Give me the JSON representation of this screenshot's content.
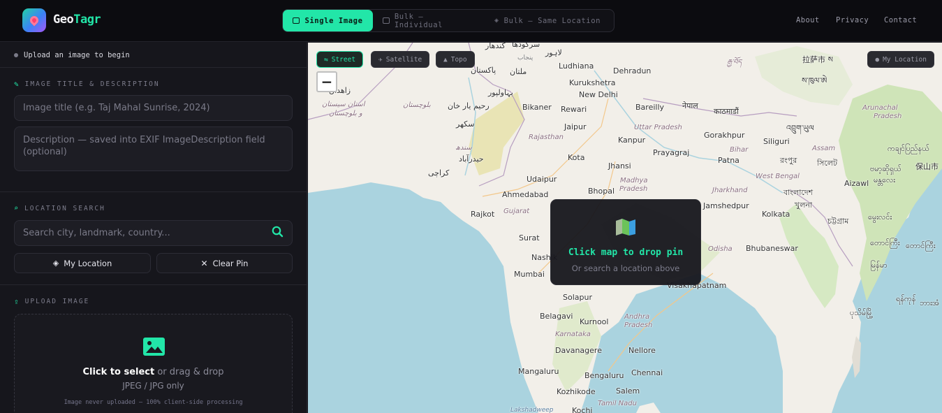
{
  "header": {
    "brand_part1": "Geo",
    "brand_part2": "Tagr",
    "modes": [
      "Single Image",
      "Bulk — Individual",
      "Bulk — Same Location"
    ],
    "nav": [
      "About",
      "Privacy",
      "Contact"
    ]
  },
  "sidebar": {
    "status": "Upload an image to begin",
    "title_section": {
      "heading": "IMAGE TITLE & DESCRIPTION",
      "title_placeholder": "Image title (e.g. Taj Mahal Sunrise, 2024)",
      "description_placeholder": "Description — saved into EXIF ImageDescription field (optional)"
    },
    "location_section": {
      "heading": "LOCATION SEARCH",
      "search_placeholder": "Search city, landmark, country...",
      "my_location": "My Location",
      "clear_pin": "Clear Pin"
    },
    "upload_section": {
      "heading": "UPLOAD IMAGE",
      "click_label": "Click to select",
      "drag_label": " or drag & drop",
      "formats": "JPEG / JPG only",
      "privacy_note": "Image never uploaded — 100% client-side processing"
    }
  },
  "map": {
    "layers": [
      "Street",
      "Satellite",
      "Topo"
    ],
    "active_layer": "Street",
    "zoom_out": "−",
    "my_location": "My Location",
    "overlay_title": "Click map to drop pin",
    "overlay_subtitle": "Or search a location above",
    "labels": {
      "kandahar": "کندهار",
      "sargodha": "سرگودھا",
      "lahore": "لاہور",
      "punjab": "پنجاب",
      "pakistan": "پاکستان",
      "multan": "ملتان",
      "zahedan": "زاهدان",
      "sistan": "استان سیستان",
      "baluchestan": "و بلوچستان",
      "balochistan": "بلوچستان",
      "bahawalpur": "بہاولپور",
      "rahimyar": "رحیم یار خان",
      "sukkur": "سکھر",
      "sindh": "سندھ",
      "hyderabad": "حیدرآباد",
      "karachi": "کراچی",
      "ludhiana": "Ludhiana",
      "kurukshetra": "Kurukshetra",
      "dehradun": "Dehradun",
      "newdelhi": "New Delhi",
      "bikaner": "Bikaner",
      "rewari": "Rewari",
      "bareilly": "Bareilly",
      "nepal": "नेपाल",
      "kathmandu": "काठमाडौं",
      "jaipur": "Jaipur",
      "uttarpradesh": "Uttar Pradesh",
      "gorakhpur": "Gorakhpur",
      "rajasthan": "Rajasthan",
      "kanpur": "Kanpur",
      "prayagraj": "Prayagraj",
      "bihar": "Bihar",
      "siliguri": "Siliguri",
      "kota": "Kota",
      "jhansi": "Jhansi",
      "patna": "Patna",
      "assam": "Assam",
      "udaipur": "Udaipur",
      "madhyapradesh": "Madhya",
      "pradesh_mp": "Pradesh",
      "westbengal": "West Bengal",
      "bhopal": "Bhopal",
      "jharkhand": "Jharkhand",
      "ahmedabad": "Ahmedabad",
      "bangladesh": "বাংলাদেশ",
      "khulna": "খুলনা",
      "rajkot": "Rajkot",
      "gujarat": "Gujarat",
      "jamshedpur": "Jamshedpur",
      "kolkata": "Kolkata",
      "chittagong": "চট্টগ্রাম",
      "surat": "Surat",
      "nashik": "Nashik",
      "odisha": "Odisha",
      "bhubaneswar": "Bhubaneswar",
      "mumbai": "Mumbai",
      "visakhapatnam": "Visakhapatnam",
      "solapur": "Solapur",
      "belagavi": "Belagavi",
      "kurnool": "Kurnool",
      "andhra": "Andhra",
      "pradesh_ap": "Pradesh",
      "karnataka": "Karnataka",
      "davanagere": "Davanagere",
      "nellore": "Nellore",
      "mangaluru": "Mangaluru",
      "bengaluru": "Bengaluru",
      "chennai": "Chennai",
      "kozhikode": "Kozhikode",
      "salem": "Salem",
      "tamilnadu": "Tamil Nadu",
      "kochi": "Kochi",
      "lakshadweep": "Lakshadweep",
      "lhasa": "拉萨市 ས",
      "tibet1": "རྒྱ་བོད",
      "tibet2": "ས་ཁུལ་ཨེ",
      "arunachal": "Arunachal",
      "arunachal2": "Pradesh",
      "sylhet": "সিলেট",
      "rangpur": "রংপুর",
      "aizawl": "Aizawl",
      "mm1": "ကချင်ပြည်နယ်",
      "mm2": "ဗမာ့ဆိုရှယ်",
      "mm3": "မန္တလေး",
      "mm4": "မွေးလင်း",
      "mm5": "တောင်ကြီး",
      "mm6": "မြန်မာ",
      "mm7": "ရန်ကုန်",
      "mm8": "ပုသိမ်မြို့",
      "mm9": "ဘားအံ",
      "baoshan": "保山市",
      "bhutan": "འབྲུག་ཡུལ"
    }
  }
}
